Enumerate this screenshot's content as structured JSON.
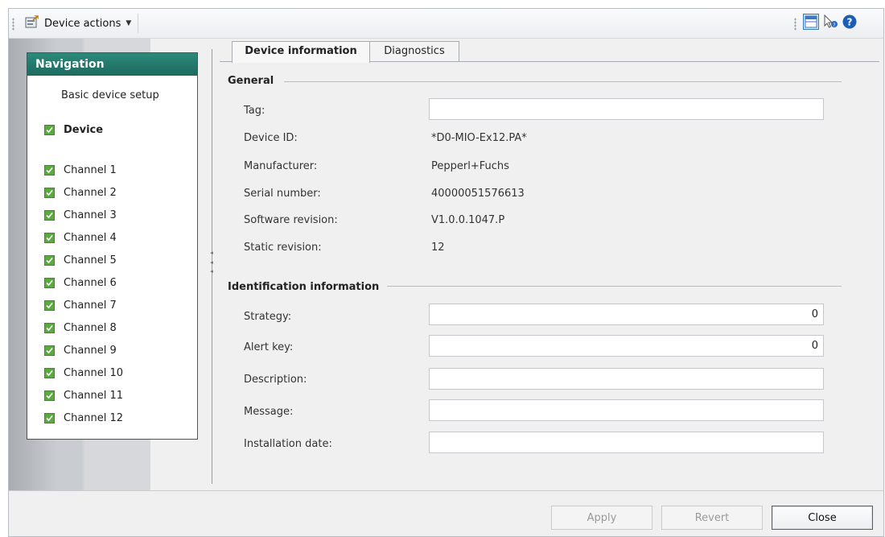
{
  "toolbar": {
    "device_actions_label": "Device actions",
    "icons": [
      "device-actions-icon",
      "window-layout-icon",
      "context-help-icon",
      "help-icon"
    ]
  },
  "navigation": {
    "title": "Navigation",
    "items": [
      {
        "label": "Basic device setup",
        "checked": false,
        "bold": false
      },
      {
        "label": "Device",
        "checked": true,
        "bold": true
      },
      {
        "label": "Channel 1",
        "checked": true
      },
      {
        "label": "Channel 2",
        "checked": true
      },
      {
        "label": "Channel 3",
        "checked": true
      },
      {
        "label": "Channel 4",
        "checked": true
      },
      {
        "label": "Channel 5",
        "checked": true
      },
      {
        "label": "Channel 6",
        "checked": true
      },
      {
        "label": "Channel 7",
        "checked": true
      },
      {
        "label": "Channel 8",
        "checked": true
      },
      {
        "label": "Channel 9",
        "checked": true
      },
      {
        "label": "Channel 10",
        "checked": true
      },
      {
        "label": "Channel 11",
        "checked": true
      },
      {
        "label": "Channel 12",
        "checked": true
      }
    ]
  },
  "tabs": [
    {
      "label": "Device information",
      "active": true
    },
    {
      "label": "Diagnostics",
      "active": false
    }
  ],
  "general": {
    "title": "General",
    "tag_label": "Tag:",
    "tag_value": "",
    "device_id_label": "Device ID:",
    "device_id_value": "*D0-MIO-Ex12.PA*",
    "manufacturer_label": "Manufacturer:",
    "manufacturer_value": "Pepperl+Fuchs",
    "serial_label": "Serial number:",
    "serial_value": "40000051576613",
    "software_label": "Software revision:",
    "software_value": "V1.0.0.1047.P",
    "static_label": "Static revision:",
    "static_value": "12"
  },
  "identification": {
    "title": "Identification information",
    "strategy_label": "Strategy:",
    "strategy_value": "0",
    "alert_label": "Alert key:",
    "alert_value": "0",
    "description_label": "Description:",
    "description_value": "",
    "message_label": "Message:",
    "message_value": "",
    "installation_label": "Installation date:",
    "installation_value": ""
  },
  "buttons": {
    "apply": "Apply",
    "revert": "Revert",
    "close": "Close"
  },
  "colors": {
    "nav_header": "#1d6a5e",
    "check_green": "#5aab3e",
    "help_blue": "#1b5fb4"
  }
}
